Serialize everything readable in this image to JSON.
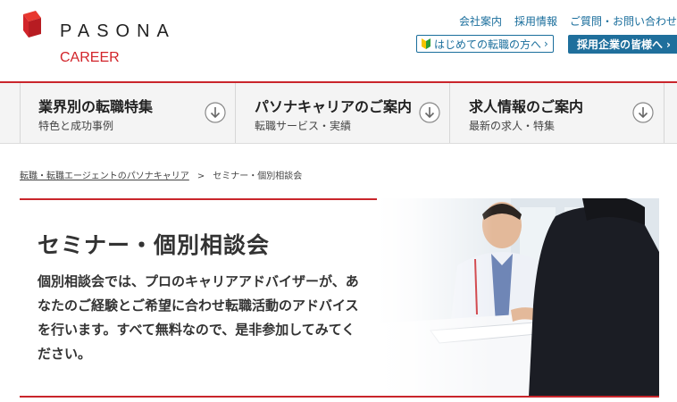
{
  "brand": {
    "name": "PASONA",
    "sub": "CAREER",
    "accent": "#d2242a"
  },
  "header": {
    "util_links": [
      "会社案内",
      "採用情報",
      "ご質問・お問い合わせ"
    ],
    "first_time_button": "はじめての転職の方へ",
    "employer_button": "採用企業の皆様へ",
    "link_color": "#1a6e9c"
  },
  "nav": {
    "items": [
      {
        "title": "業界別の転職特集",
        "sub": "特色と成功事例",
        "icon": "circle-down-arrow-icon"
      },
      {
        "title": "パソナキャリアのご案内",
        "sub": "転職サービス・実績",
        "icon": "circle-down-arrow-icon"
      },
      {
        "title": "求人情報のご案内",
        "sub": "最新の求人・特集",
        "icon": "circle-down-arrow-icon"
      }
    ]
  },
  "breadcrumb": {
    "home": "転職・転職エージェントのパソナキャリア",
    "separator": ">",
    "current": "セミナー・個別相談会"
  },
  "hero": {
    "title": "セミナー・個別相談会",
    "description": "個別相談会では、プロのキャリアアドバイザーが、あなたのご経験とご希望に合わせ転職活動のアドバイスを行います。すべて無料なので、是非参加してみてください。"
  }
}
